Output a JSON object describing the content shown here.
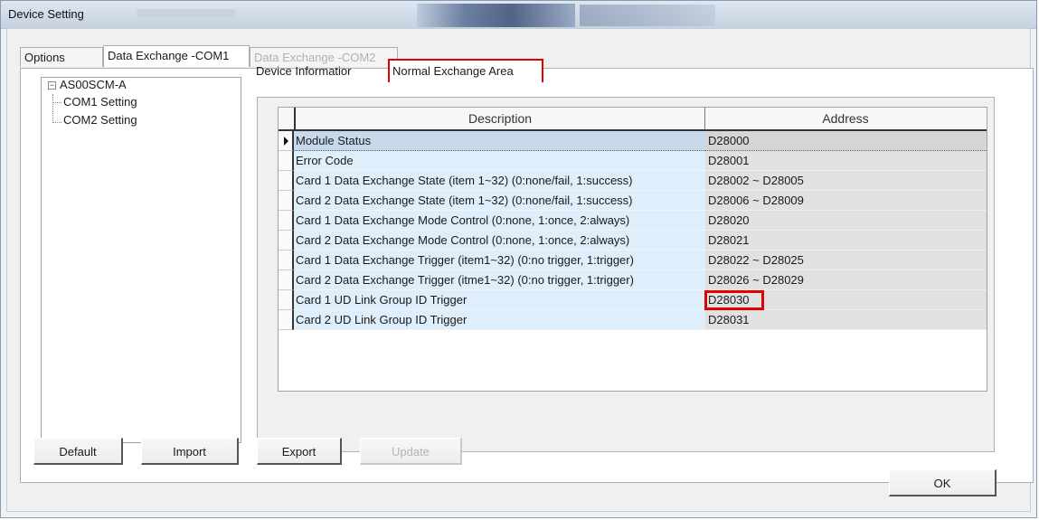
{
  "window": {
    "title": "Device Setting"
  },
  "top_tabs": [
    {
      "label": "Options"
    },
    {
      "label": "Data Exchange -COM1"
    },
    {
      "label": "Data Exchange -COM2"
    }
  ],
  "tree": {
    "root": "AS00SCM-A",
    "children": [
      "COM1 Setting",
      "COM2 Setting"
    ]
  },
  "inner_tabs": [
    {
      "label": "Device Informatior"
    },
    {
      "label": "Normal Exchange Area"
    }
  ],
  "grid": {
    "columns": [
      "Description",
      "Address"
    ],
    "rows": [
      {
        "description": "Module Status",
        "address": "D28000"
      },
      {
        "description": "Error Code",
        "address": "D28001"
      },
      {
        "description": "Card 1 Data Exchange State (item 1~32) (0:none/fail, 1:success)",
        "address": "D28002 ~ D28005"
      },
      {
        "description": "Card 2 Data Exchange State (item 1~32) (0:none/fail, 1:success)",
        "address": "D28006 ~ D28009"
      },
      {
        "description": "Card 1 Data Exchange Mode Control (0:none, 1:once, 2:always)",
        "address": "D28020"
      },
      {
        "description": "Card 2 Data Exchange Mode Control (0:none, 1:once, 2:always)",
        "address": "D28021"
      },
      {
        "description": "Card 1 Data Exchange Trigger (item1~32) (0:no trigger, 1:trigger)",
        "address": "D28022 ~ D28025"
      },
      {
        "description": "Card 2 Data Exchange Trigger (itme1~32) (0:no trigger, 1:trigger)",
        "address": "D28026 ~ D28029"
      },
      {
        "description": "Card 1 UD Link Group ID Trigger",
        "address": "D28030"
      },
      {
        "description": "Card 2 UD Link Group ID Trigger",
        "address": "D28031"
      }
    ]
  },
  "buttons": {
    "default": "Default",
    "import": "Import",
    "export": "Export",
    "update": "Update",
    "ok": "OK"
  },
  "colors": {
    "highlight": "#e30000",
    "row_desc_bg": "#dfeefb",
    "row_addr_bg": "#e1e1e1"
  }
}
